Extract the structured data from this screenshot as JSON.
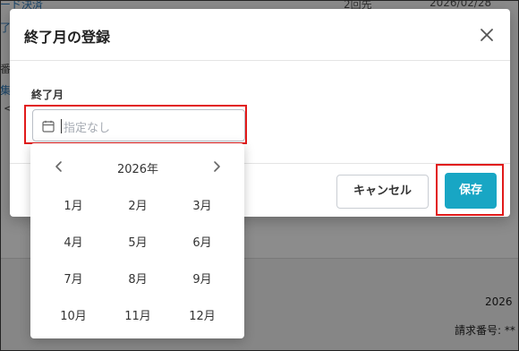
{
  "background": {
    "row1_label": "ード決済",
    "row1_count": "2回先",
    "row1_date": "2026/02/28",
    "left_fragments": [
      "了",
      "番",
      "集",
      "<"
    ],
    "date_fragment": "2026",
    "invoice_label": "請求番号: **"
  },
  "modal": {
    "title": "終了月の登録",
    "close_icon": "close-icon",
    "field_label": "終了月",
    "input_placeholder": "指定なし",
    "input_icon": "calendar-icon",
    "cancel_label": "キャンセル",
    "save_label": "保存",
    "accent_color": "#18a6c4",
    "highlight_color": "#e11a1a"
  },
  "picker": {
    "year": "2026年",
    "prev_icon": "chevron-left-icon",
    "next_icon": "chevron-right-icon",
    "months": [
      "1月",
      "2月",
      "3月",
      "4月",
      "5月",
      "6月",
      "7月",
      "8月",
      "9月",
      "10月",
      "11月",
      "12月"
    ]
  }
}
